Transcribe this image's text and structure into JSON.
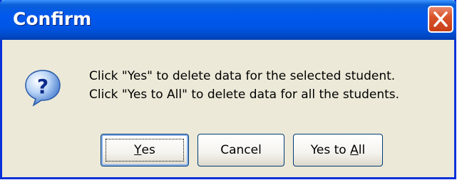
{
  "window": {
    "title": "Confirm",
    "close_icon": "close-icon",
    "accent": "#0055e3",
    "close_color": "#d9542b"
  },
  "message": {
    "icon": "question-icon",
    "line1": "Click \"Yes\" to delete data for the selected student.",
    "line2": "Click \"Yes to All\" to delete data for all the students."
  },
  "buttons": {
    "yes": {
      "mnemonic": "Y",
      "rest": "es"
    },
    "cancel": {
      "label": "Cancel"
    },
    "yes_to_all": {
      "prefix": "Yes to ",
      "mnemonic": "A",
      "rest": "ll"
    }
  }
}
